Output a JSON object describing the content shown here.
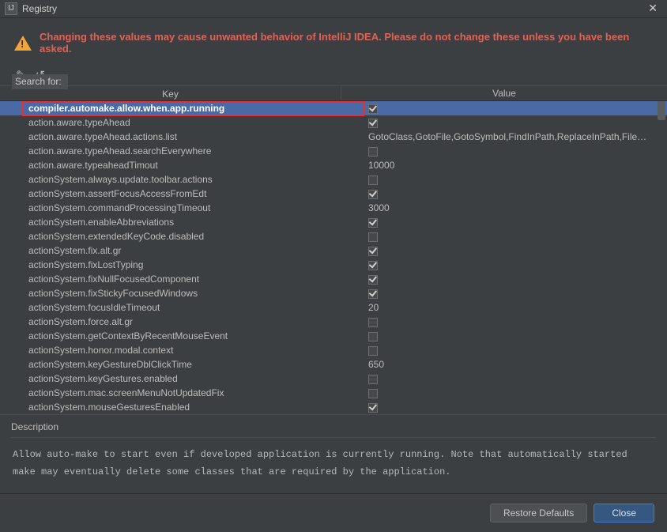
{
  "titlebar": {
    "app_icon_text": "IJ",
    "title": "Registry",
    "close_glyph": "✕"
  },
  "warning": {
    "text": "Changing these values may cause unwanted behavior of IntelliJ IDEA. Please do not change these unless you have been asked."
  },
  "toolbar": {
    "edit_glyph": "✎",
    "undo_glyph": "↺"
  },
  "search": {
    "label": "Search for:"
  },
  "table": {
    "header_key": "Key",
    "header_value": "Value",
    "rows": [
      {
        "key": "compiler.automake.allow.when.app.running",
        "type": "check",
        "checked": true,
        "selected": true,
        "highlighted": true
      },
      {
        "key": "action.aware.typeAhead",
        "type": "check",
        "checked": true
      },
      {
        "key": "action.aware.typeAhead.actions.list",
        "type": "text",
        "value": "GotoClass,GotoFile,GotoSymbol,FindInPath,ReplaceInPath,FileStru..."
      },
      {
        "key": "action.aware.typeAhead.searchEverywhere",
        "type": "check",
        "checked": false
      },
      {
        "key": "action.aware.typeaheadTimout",
        "type": "text",
        "value": "10000"
      },
      {
        "key": "actionSystem.always.update.toolbar.actions",
        "type": "check",
        "checked": false
      },
      {
        "key": "actionSystem.assertFocusAccessFromEdt",
        "type": "check",
        "checked": true
      },
      {
        "key": "actionSystem.commandProcessingTimeout",
        "type": "text",
        "value": "3000"
      },
      {
        "key": "actionSystem.enableAbbreviations",
        "type": "check",
        "checked": true
      },
      {
        "key": "actionSystem.extendedKeyCode.disabled",
        "type": "check",
        "checked": false
      },
      {
        "key": "actionSystem.fix.alt.gr",
        "type": "check",
        "checked": true
      },
      {
        "key": "actionSystem.fixLostTyping",
        "type": "check",
        "checked": true
      },
      {
        "key": "actionSystem.fixNullFocusedComponent",
        "type": "check",
        "checked": true
      },
      {
        "key": "actionSystem.fixStickyFocusedWindows",
        "type": "check",
        "checked": true
      },
      {
        "key": "actionSystem.focusIdleTimeout",
        "type": "text",
        "value": "20"
      },
      {
        "key": "actionSystem.force.alt.gr",
        "type": "check",
        "checked": false
      },
      {
        "key": "actionSystem.getContextByRecentMouseEvent",
        "type": "check",
        "checked": false
      },
      {
        "key": "actionSystem.honor.modal.context",
        "type": "check",
        "checked": false
      },
      {
        "key": "actionSystem.keyGestureDblClickTime",
        "type": "text",
        "value": "650"
      },
      {
        "key": "actionSystem.keyGestures.enabled",
        "type": "check",
        "checked": false
      },
      {
        "key": "actionSystem.mac.screenMenuNotUpdatedFix",
        "type": "check",
        "checked": false
      },
      {
        "key": "actionSystem.mouseGesturesEnabled",
        "type": "check",
        "checked": true
      }
    ]
  },
  "description": {
    "label": "Description",
    "body": "Allow auto-make to start even if developed application is currently running. Note that automatically started make may eventually delete some classes that are required by the application."
  },
  "footer": {
    "restore": "Restore Defaults",
    "close": "Close"
  }
}
